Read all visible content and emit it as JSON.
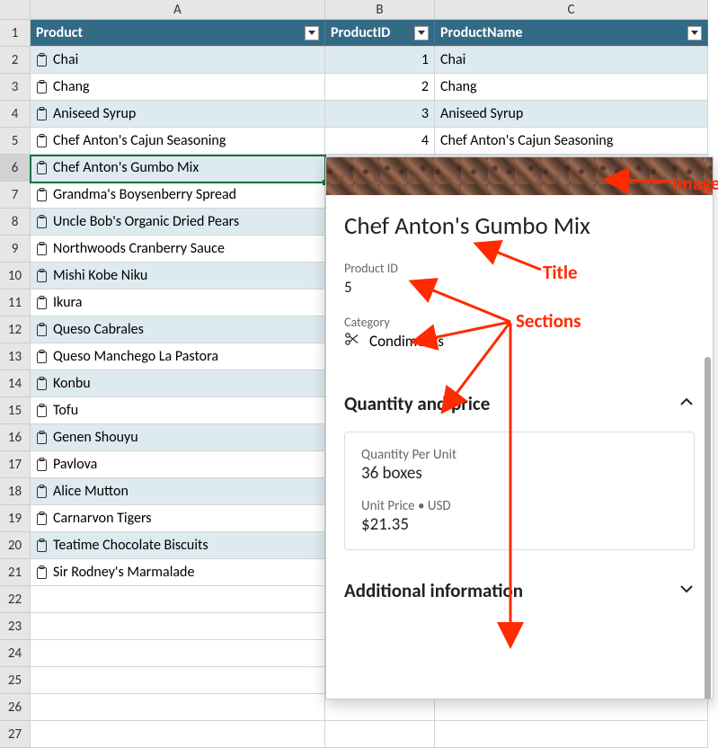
{
  "columns": {
    "A": "A",
    "B": "B",
    "C": "C"
  },
  "headers": {
    "product": "Product",
    "productId": "ProductID",
    "productName": "ProductName"
  },
  "rows": [
    {
      "product": "Chai",
      "id": "1",
      "name": "Chai"
    },
    {
      "product": "Chang",
      "id": "2",
      "name": "Chang"
    },
    {
      "product": "Aniseed Syrup",
      "id": "3",
      "name": "Aniseed Syrup"
    },
    {
      "product": "Chef Anton's Cajun Seasoning",
      "id": "4",
      "name": "Chef Anton's Cajun Seasoning"
    },
    {
      "product": "Chef Anton's Gumbo Mix",
      "id": "",
      "name": ""
    },
    {
      "product": "Grandma's Boysenberry Spread",
      "id": "",
      "name": ""
    },
    {
      "product": "Uncle Bob's Organic Dried Pears",
      "id": "",
      "name": ""
    },
    {
      "product": "Northwoods Cranberry Sauce",
      "id": "",
      "name": ""
    },
    {
      "product": "Mishi Kobe Niku",
      "id": "",
      "name": ""
    },
    {
      "product": "Ikura",
      "id": "",
      "name": ""
    },
    {
      "product": "Queso Cabrales",
      "id": "",
      "name": ""
    },
    {
      "product": "Queso Manchego La Pastora",
      "id": "",
      "name": ""
    },
    {
      "product": "Konbu",
      "id": "",
      "name": ""
    },
    {
      "product": "Tofu",
      "id": "",
      "name": ""
    },
    {
      "product": "Genen Shouyu",
      "id": "",
      "name": ""
    },
    {
      "product": "Pavlova",
      "id": "",
      "name": ""
    },
    {
      "product": "Alice Mutton",
      "id": "",
      "name": ""
    },
    {
      "product": "Carnarvon Tigers",
      "id": "",
      "name": ""
    },
    {
      "product": "Teatime Chocolate Biscuits",
      "id": "",
      "name": ""
    },
    {
      "product": "Sir Rodney's Marmalade",
      "id": "",
      "name": ""
    }
  ],
  "rowNumbers": [
    "1",
    "2",
    "3",
    "4",
    "5",
    "6",
    "7",
    "8",
    "9",
    "10",
    "11",
    "12",
    "13",
    "14",
    "15",
    "16",
    "17",
    "18",
    "19",
    "20",
    "21",
    "22",
    "23",
    "24",
    "25",
    "26",
    "27"
  ],
  "card": {
    "title": "Chef Anton's Gumbo Mix",
    "productId": {
      "label": "Product ID",
      "value": "5"
    },
    "category": {
      "label": "Category",
      "value": "Condiments"
    },
    "qpHeader": "Quantity and price",
    "qpu": {
      "label": "Quantity Per Unit",
      "value": "36 boxes"
    },
    "unitPrice": {
      "label": "Unit Price • USD",
      "value": "$21.35"
    },
    "addlHeader": "Additional information"
  },
  "annotations": {
    "image": "Image",
    "title": "Title",
    "sections": "Sections"
  }
}
